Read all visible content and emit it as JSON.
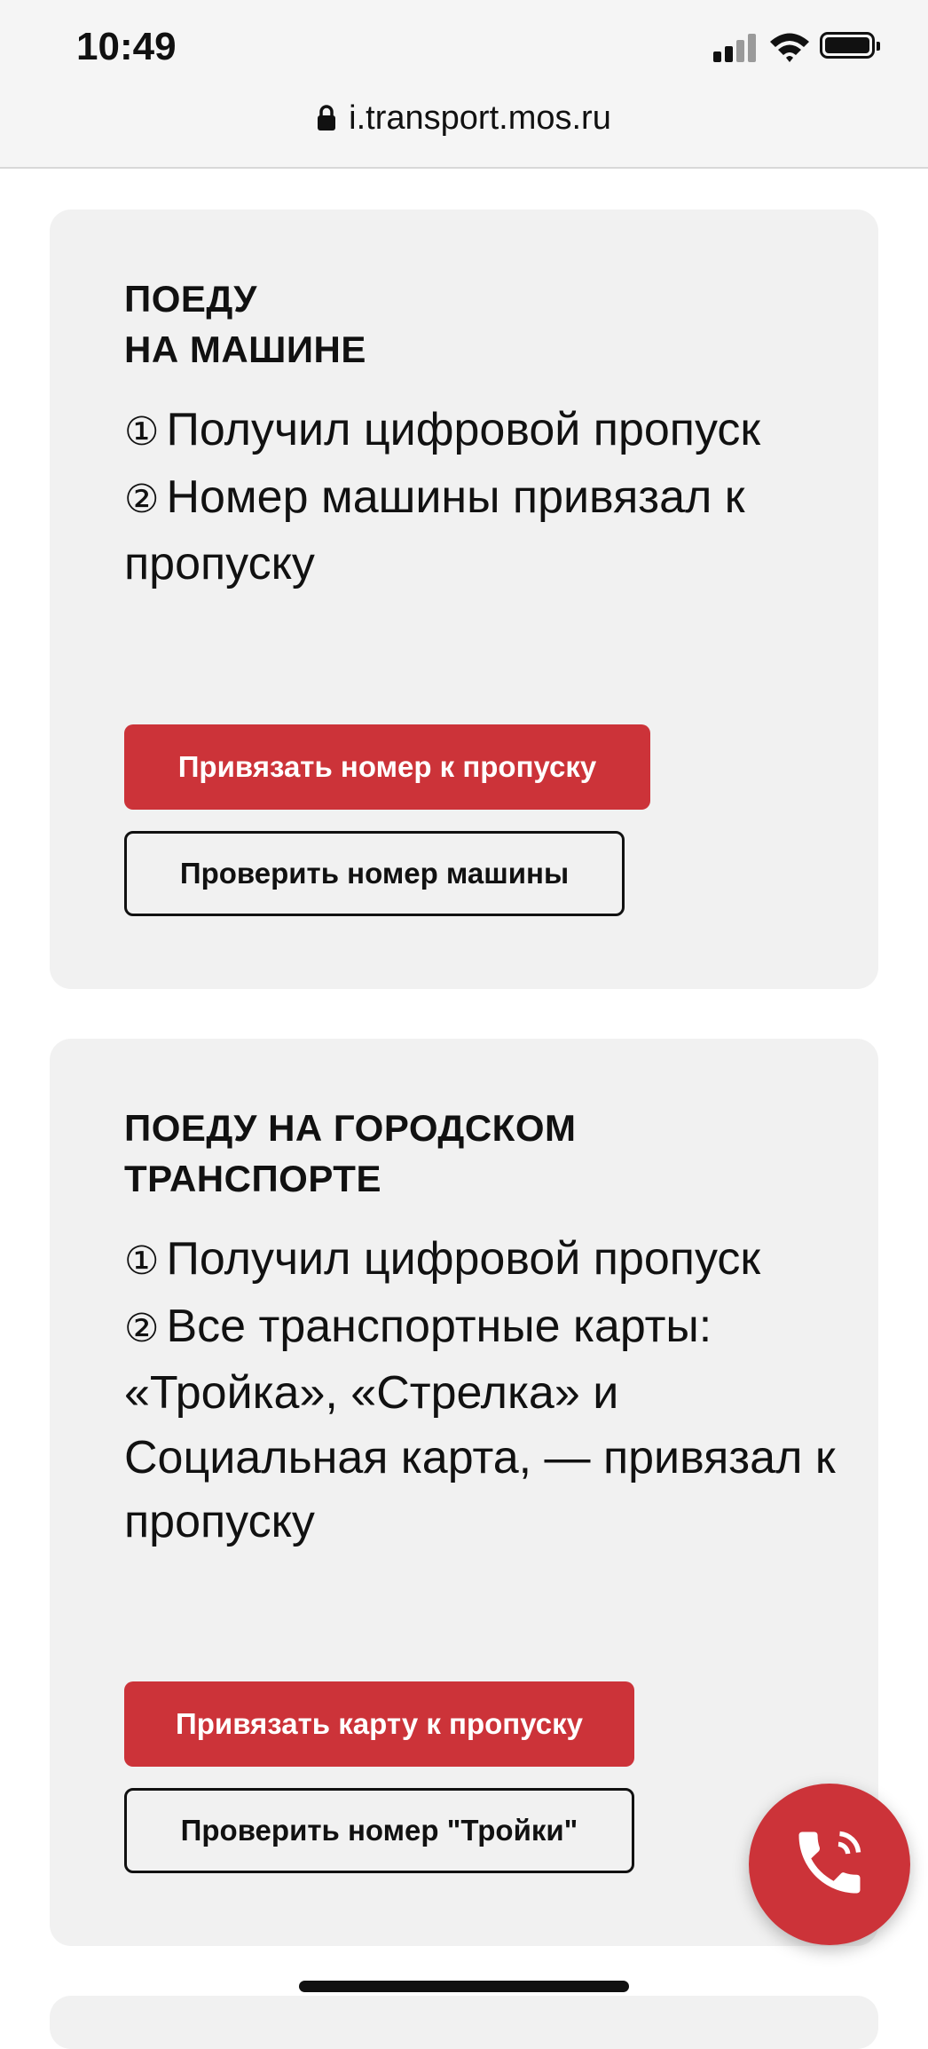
{
  "status_bar": {
    "time": "10:49"
  },
  "browser": {
    "url": "i.transport.mos.ru"
  },
  "cards": [
    {
      "title": "ПОЕДУ\nНА МАШИНЕ",
      "steps": [
        {
          "number": "①",
          "text": "Получил цифровой пропуск"
        },
        {
          "number": "②",
          "text": "Номер машины привязал к пропуску"
        }
      ],
      "primary_button": "Привязать номер к пропуску",
      "secondary_button": "Проверить номер машины"
    },
    {
      "title": "ПОЕДУ НА ГОРОДСКОМ ТРАНСПОРТЕ",
      "steps": [
        {
          "number": "①",
          "text": "Получил цифровой пропуск"
        },
        {
          "number": "②",
          "text": "Все транспортные карты: «Тройка», «Стрелка» и Социальная карта, — привязал к пропуску"
        }
      ],
      "primary_button": "Привязать карту к пропуску",
      "secondary_button": "Проверить номер \"Тройки\""
    }
  ],
  "fab": {
    "icon": "phone-icon"
  },
  "colors": {
    "accent": "#cc3339",
    "card_bg": "#f1f1f1"
  }
}
